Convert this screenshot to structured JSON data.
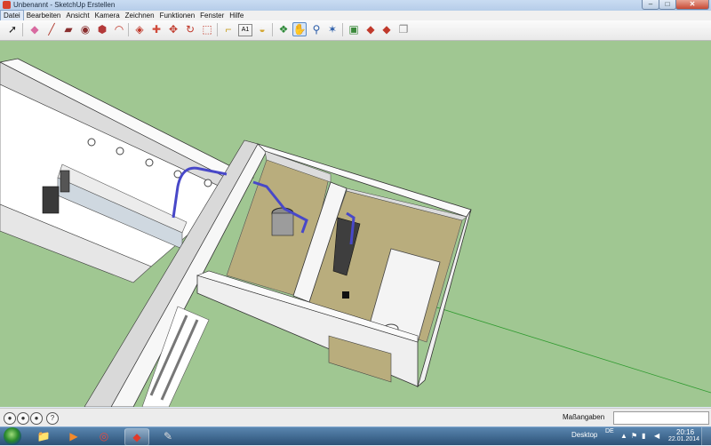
{
  "window": {
    "title": "Unbenannt - SketchUp Erstellen",
    "min_glyph": "–",
    "max_glyph": "□",
    "close_glyph": "✕"
  },
  "menubar": {
    "items": [
      "Datei",
      "Bearbeiten",
      "Ansicht",
      "Kamera",
      "Zeichnen",
      "Funktionen",
      "Fenster",
      "Hilfe"
    ]
  },
  "toolbar": {
    "tools": [
      {
        "name": "select-tool-icon",
        "glyph": "➚",
        "color": "#222222"
      },
      {
        "name": "eraser-tool-icon",
        "glyph": "◆",
        "color": "#d86aa0"
      },
      {
        "name": "pencil-line-tool-icon",
        "glyph": "╱",
        "color": "#b03a2e"
      },
      {
        "name": "rectangle-tool-icon",
        "glyph": "▰",
        "color": "#8a2f2f"
      },
      {
        "name": "circle-tool-icon",
        "glyph": "◉",
        "color": "#8a2f2f"
      },
      {
        "name": "polygon-tool-icon",
        "glyph": "⬢",
        "color": "#b33939"
      },
      {
        "name": "arc-tool-icon",
        "glyph": "◠",
        "color": "#c0392b"
      },
      {
        "name": "push-pull-tool-icon",
        "glyph": "◈",
        "color": "#c0392b"
      },
      {
        "name": "follow-me-tool-icon",
        "glyph": "✚",
        "color": "#d04a3a"
      },
      {
        "name": "move-tool-icon",
        "glyph": "✥",
        "color": "#c0392b"
      },
      {
        "name": "rotate-tool-icon",
        "glyph": "↻",
        "color": "#c0392b"
      },
      {
        "name": "scale-tool-icon",
        "glyph": "⬚",
        "color": "#c0392b"
      },
      {
        "name": "tape-measure-tool-icon",
        "glyph": "⌐",
        "color": "#c8a12a"
      },
      {
        "name": "text-tool-icon",
        "glyph": "A",
        "color": "#333333"
      },
      {
        "name": "paint-bucket-tool-icon",
        "glyph": "◒",
        "color": "#d3a630"
      },
      {
        "name": "orbit-tool-icon",
        "glyph": "❖",
        "color": "#2f8a3a"
      },
      {
        "name": "pan-tool-icon",
        "glyph": "✋",
        "color": "#333333"
      },
      {
        "name": "zoom-tool-icon",
        "glyph": "⚲",
        "color": "#2a5ca8"
      },
      {
        "name": "zoom-extents-tool-icon",
        "glyph": "✶",
        "color": "#2a5ca8"
      },
      {
        "name": "3d-warehouse-icon",
        "glyph": "▣",
        "color": "#3c8a3c"
      },
      {
        "name": "share-model-icon",
        "glyph": "◆",
        "color": "#c0392b"
      },
      {
        "name": "get-models-icon",
        "glyph": "◆",
        "color": "#c0392b"
      },
      {
        "name": "extension-warehouse-icon",
        "glyph": "❐",
        "color": "#888888"
      }
    ],
    "text_tool_label": "A1"
  },
  "statusbar": {
    "measurements_label": "Maßangaben",
    "measurements_value": ""
  },
  "taskbar": {
    "apps": [
      {
        "name": "explorer-taskbar-icon",
        "glyph": "📁"
      },
      {
        "name": "media-player-taskbar-icon",
        "glyph": "▶"
      },
      {
        "name": "chrome-taskbar-icon",
        "glyph": "◎"
      },
      {
        "name": "sketchup-taskbar-icon",
        "glyph": "◆"
      },
      {
        "name": "gimp-taskbar-icon",
        "glyph": "✎"
      }
    ],
    "desktop_label": "Desktop",
    "language": "DE",
    "time": "20:16",
    "date": "22.01.2014"
  },
  "colors": {
    "sky": "#dfe9f5",
    "ground": "#a0c792",
    "wall": "#f2f2f2",
    "floor": "#b9ad7d",
    "pipe": "#4848c8"
  }
}
